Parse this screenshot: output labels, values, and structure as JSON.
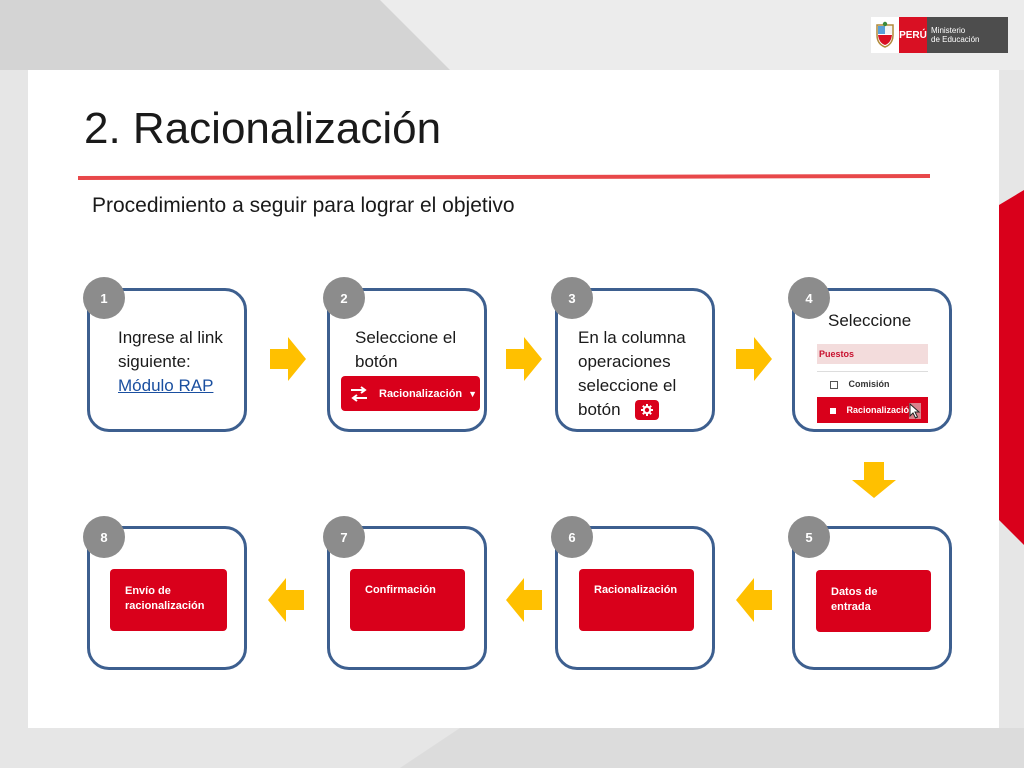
{
  "header": {
    "logo_country": "PERÚ",
    "logo_ministry_line1": "Ministerio",
    "logo_ministry_line2": "de Educación"
  },
  "title": "2. Racionalización",
  "subtitle": "Procedimiento a seguir para lograr el objetivo",
  "steps": {
    "s1": {
      "number": "1",
      "line1": "Ingrese al link",
      "line2": "siguiente:",
      "link": "Módulo RAP"
    },
    "s2": {
      "number": "2",
      "line1": "Seleccione el",
      "line2": "botón",
      "button": "Racionalización"
    },
    "s3": {
      "number": "3",
      "line1": "En la columna",
      "line2": "operaciones",
      "line3": "seleccione el",
      "line4": "botón"
    },
    "s4": {
      "number": "4",
      "text": "Seleccione",
      "menu_header": "Puestos",
      "menu_item1": "Comisión",
      "menu_item2": "Racionalización"
    },
    "s5": {
      "number": "5",
      "button_line1": "Datos de",
      "button_line2": "entrada"
    },
    "s6": {
      "number": "6",
      "button": "Racionalización"
    },
    "s7": {
      "number": "7",
      "button": "Confirmación"
    },
    "s8": {
      "number": "8",
      "button_line1": "Envío de",
      "button_line2": "racionalización"
    }
  },
  "colors": {
    "accent_red": "#d9001b",
    "box_border": "#3d5f8f",
    "arrow": "#ffc000",
    "badge": "#8c8c8c"
  }
}
